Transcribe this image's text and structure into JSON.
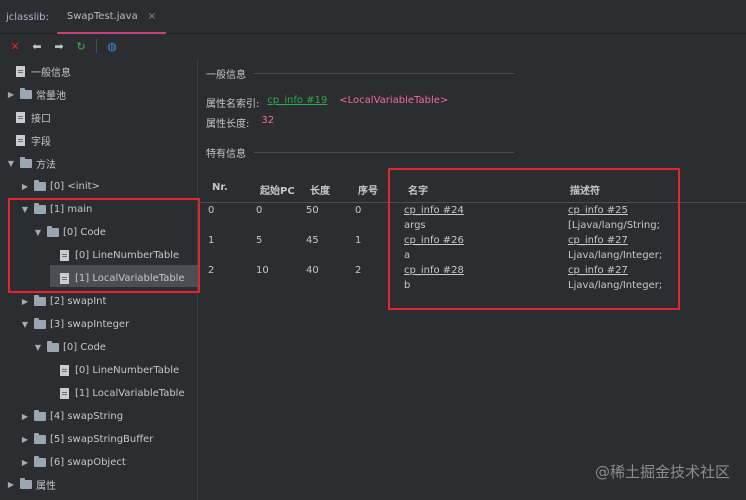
{
  "titlebar": {
    "app_title": "jclasslib:",
    "tab_label": "SwapTest.java",
    "tab_close": "×"
  },
  "toolbar": {
    "icons": [
      "close-icon",
      "back-icon",
      "forward-icon",
      "refresh-icon",
      "web-icon"
    ],
    "close_glyph": "✕",
    "back_glyph": "⬅",
    "forward_glyph": "➡",
    "refresh_glyph": "↻",
    "web_glyph": "◍"
  },
  "tree": {
    "general_info": "一般信息",
    "constant_pool": "常量池",
    "interfaces": "接口",
    "fields": "字段",
    "methods": "方法",
    "m0": "[0] <init>",
    "m1": "[1] main",
    "m1_code": "[0] Code",
    "m1_lnt": "[0] LineNumberTable",
    "m1_lvt": "[1] LocalVariableTable",
    "m2": "[2] swapInt",
    "m3": "[3] swapInteger",
    "m3_code": "[0] Code",
    "m3_lnt": "[0] LineNumberTable",
    "m3_lvt": "[1] LocalVariableTable",
    "m4": "[4] swapString",
    "m5": "[5] swapStringBuffer",
    "m6": "[6] swapObject",
    "attributes": "属性"
  },
  "general": {
    "section_title": "一般信息",
    "name_index_label": "属性名索引:",
    "name_index_link": "cp_info #19",
    "name_index_value": "<LocalVariableTable>",
    "length_label": "属性长度:",
    "length_value": "32"
  },
  "specific": {
    "section_title": "特有信息",
    "columns": {
      "nr": "Nr.",
      "start_pc": "起始PC",
      "length": "长度",
      "index": "序号",
      "name": "名字",
      "descriptor": "描述符"
    },
    "rows": [
      {
        "nr": "0",
        "start_pc": "0",
        "length": "50",
        "index": "0",
        "name_link": "cp_info #24",
        "name": "args",
        "desc_link": "cp_info #25",
        "desc": "[Ljava/lang/String;"
      },
      {
        "nr": "1",
        "start_pc": "5",
        "length": "45",
        "index": "1",
        "name_link": "cp_info #26",
        "name": "a",
        "desc_link": "cp_info #27",
        "desc": "Ljava/lang/Integer;"
      },
      {
        "nr": "2",
        "start_pc": "10",
        "length": "40",
        "index": "2",
        "name_link": "cp_info #28",
        "name": "b",
        "desc_link": "cp_info #27",
        "desc": "Ljava/lang/Integer;"
      }
    ]
  },
  "watermark": "@稀土掘金技术社区",
  "colors": {
    "accent_tab": "#c94078",
    "highlight_box": "#e0262f",
    "link": "#2fa84f",
    "value_pink": "#f06ba0"
  }
}
